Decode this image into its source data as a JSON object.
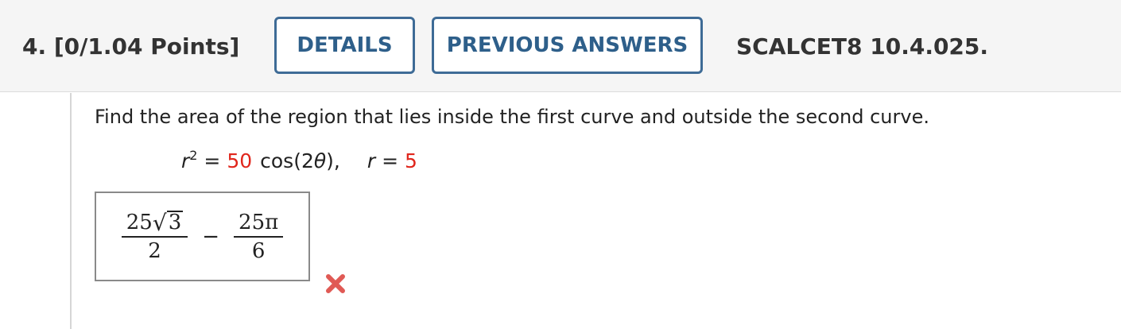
{
  "header": {
    "question_label": "4. [0/1.04 Points]",
    "details_label": "DETAILS",
    "previous_answers_label": "PREVIOUS ANSWERS",
    "question_code": "SCALCET8 10.4.025."
  },
  "problem": {
    "prompt": "Find the area of the region that lies inside the first curve and outside the second curve.",
    "eq1_lhs_var": "r",
    "eq1_lhs_exp": "2",
    "eq1_equals": " = ",
    "eq1_coef": "50",
    "eq1_func": "cos(2",
    "eq1_theta": "θ",
    "eq1_close": "),",
    "eq2_var": "r",
    "eq2_equals": " = ",
    "eq2_value": "5"
  },
  "answer": {
    "frac1_coef": "25",
    "frac1_radical": "√",
    "frac1_radicand": "3",
    "frac1_den": "2",
    "operator": "−",
    "frac2_num": "25π",
    "frac2_den": "6",
    "status_icon": "incorrect-x-icon"
  },
  "colors": {
    "button_border": "#3e6b96",
    "button_text": "#2e5f8a",
    "highlight_red": "#e0261c",
    "incorrect_icon": "#e05a55"
  }
}
